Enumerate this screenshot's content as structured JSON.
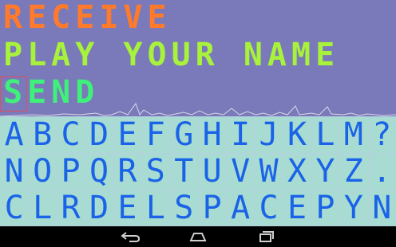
{
  "lines": {
    "receive": "RECEIVE",
    "play": "PLAY YOUR NAME",
    "send": "SEND"
  },
  "colors": {
    "receive": "#ff7a2b",
    "play": "#a8f23b",
    "send": "#3ff07a",
    "top_bg": "#7a79b9",
    "kb_bg": "#a8dcd2",
    "key_text": "#1a63e8"
  },
  "keyboard": {
    "rows": [
      [
        "A",
        "B",
        "C",
        "D",
        "E",
        "F",
        "G",
        "H",
        "I",
        "J",
        "K",
        "L",
        "M",
        "?"
      ],
      [
        "N",
        "O",
        "P",
        "Q",
        "R",
        "S",
        "T",
        "U",
        "V",
        "W",
        "X",
        "Y",
        "Z",
        "."
      ],
      [
        "C",
        "L",
        "R",
        "D",
        "E",
        "L",
        "S",
        "P",
        "A",
        "C",
        "E",
        "P",
        "Y",
        "N"
      ]
    ]
  },
  "navbar": {
    "icons": [
      "back-icon",
      "home-icon",
      "recents-icon"
    ]
  }
}
